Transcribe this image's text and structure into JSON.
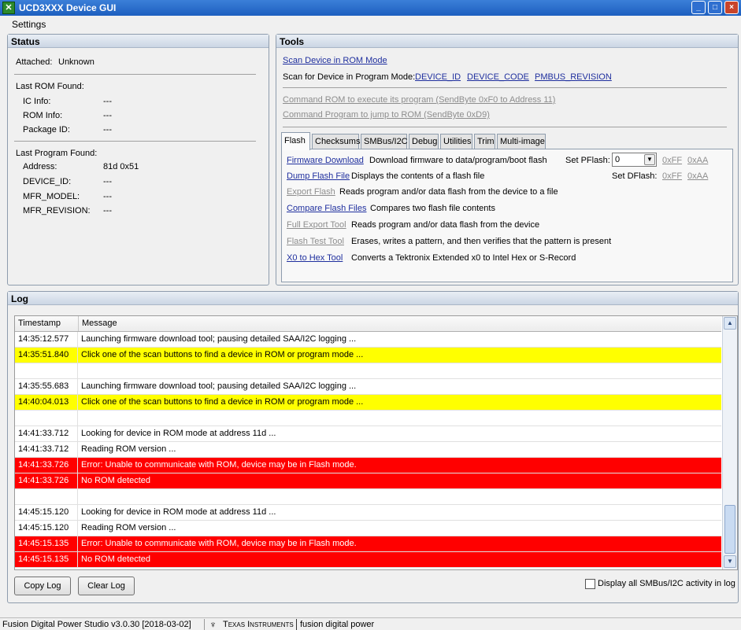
{
  "window": {
    "icon": "ucd-app-icon",
    "title": "UCD3XXX Device GUI",
    "controls": [
      "_",
      "□",
      "×"
    ]
  },
  "menu": {
    "settings": "Settings"
  },
  "status": {
    "header": "Status",
    "attached_label": "Attached:",
    "attached_value": "Unknown",
    "last_rom_label": "Last ROM Found:",
    "rom_fields": [
      {
        "label": "IC Info:",
        "value": "---"
      },
      {
        "label": "ROM Info:",
        "value": "---"
      },
      {
        "label": "Package ID:",
        "value": "---"
      }
    ],
    "last_program_label": "Last Program Found:",
    "program_fields": [
      {
        "label": "Address:",
        "value": "81d 0x51"
      },
      {
        "label": "DEVICE_ID:",
        "value": "---"
      },
      {
        "label": "MFR_MODEL:",
        "value": "---"
      },
      {
        "label": "MFR_REVISION:",
        "value": "---"
      }
    ]
  },
  "tools": {
    "header": "Tools",
    "scan_rom": "Scan Device in ROM Mode",
    "scan_program_label": "Scan for Device in Program Mode:",
    "scan_device_id": "DEVICE_ID",
    "scan_device_code": "DEVICE_CODE",
    "scan_pmbus_revision": "PMBUS_REVISION",
    "cmd_rom": "Command ROM to execute its program (SendByte 0xF0 to Address 11)",
    "cmd_program": "Command Program to jump to ROM (SendByte 0xD9)",
    "tabs": [
      "Flash",
      "Checksums",
      "SMBus/I2C",
      "Debug",
      "Utilities",
      "Trim",
      "Multi-image"
    ],
    "active_tab": "Flash",
    "flash_tools": [
      {
        "link": "Firmware Download",
        "desc": "Download firmware to data/program/boot flash",
        "enabled": true
      },
      {
        "link": "Dump Flash File",
        "desc": "Displays the contents of a flash file",
        "enabled": true
      },
      {
        "link": "Export Flash",
        "desc": "Reads program and/or data flash from the device to a file",
        "enabled": false
      },
      {
        "link": "Compare Flash Files",
        "desc": "Compares two flash file contents",
        "enabled": true
      },
      {
        "link": "Full Export Tool",
        "desc": "Reads program and/or data flash from the device",
        "enabled": false
      },
      {
        "link": "Flash Test Tool",
        "desc": "Erases, writes a pattern, and then verifies that the pattern is present",
        "enabled": false
      },
      {
        "link": "X0 to Hex Tool",
        "desc": "Converts a Tektronix Extended x0 to Intel Hex or S-Record",
        "enabled": true
      }
    ],
    "set_pflash_label": "Set PFlash:",
    "set_pflash_value": "0",
    "set_pflash_ff": "0xFF",
    "set_pflash_aa": "0xAA",
    "set_dflash_label": "Set DFlash:",
    "set_dflash_ff": "0xFF",
    "set_dflash_aa": "0xAA"
  },
  "log": {
    "header": "Log",
    "columns": [
      "Timestamp",
      "Message"
    ],
    "rows": [
      {
        "ts": "14:35:12.577",
        "msg": "Launching firmware download tool; pausing detailed SAA/I2C logging ...",
        "type": "normal"
      },
      {
        "ts": "14:35:51.840",
        "msg": "Click one of the scan buttons to find a device in ROM or program mode ...",
        "type": "warn"
      },
      {
        "ts": "",
        "msg": "",
        "type": "normal"
      },
      {
        "ts": "14:35:55.683",
        "msg": "Launching firmware download tool; pausing detailed SAA/I2C logging ...",
        "type": "normal"
      },
      {
        "ts": "14:40:04.013",
        "msg": "Click one of the scan buttons to find a device in ROM or program mode ...",
        "type": "warn"
      },
      {
        "ts": "",
        "msg": "",
        "type": "normal"
      },
      {
        "ts": "14:41:33.712",
        "msg": "Looking for device in ROM mode at address 11d ...",
        "type": "normal"
      },
      {
        "ts": "14:41:33.712",
        "msg": "Reading ROM version ...",
        "type": "normal"
      },
      {
        "ts": "14:41:33.726",
        "msg": "Error: Unable to communicate with ROM, device may be in Flash mode.",
        "type": "err"
      },
      {
        "ts": "14:41:33.726",
        "msg": "No ROM detected",
        "type": "err"
      },
      {
        "ts": "",
        "msg": "",
        "type": "normal"
      },
      {
        "ts": "14:45:15.120",
        "msg": "Looking for device in ROM mode at address 11d ...",
        "type": "normal"
      },
      {
        "ts": "14:45:15.120",
        "msg": "Reading ROM version ...",
        "type": "normal"
      },
      {
        "ts": "14:45:15.135",
        "msg": "Error: Unable to communicate with ROM, device may be in Flash mode.",
        "type": "err"
      },
      {
        "ts": "14:45:15.135",
        "msg": "No ROM detected",
        "type": "err"
      }
    ],
    "copy_button": "Copy Log",
    "clear_button": "Clear Log",
    "display_all_label": "Display all SMBus/I2C activity in log",
    "display_all_checked": false
  },
  "statusbar": {
    "version": "Fusion Digital Power Studio v3.0.30 [2018-03-02]",
    "brand": "Texas Instruments",
    "product": "fusion digital power"
  },
  "colors": {
    "warn_row": "#ffff00",
    "error_row": "#ff0000",
    "link": "#1f2f9e",
    "disabled_link": "#8d8d8d"
  }
}
